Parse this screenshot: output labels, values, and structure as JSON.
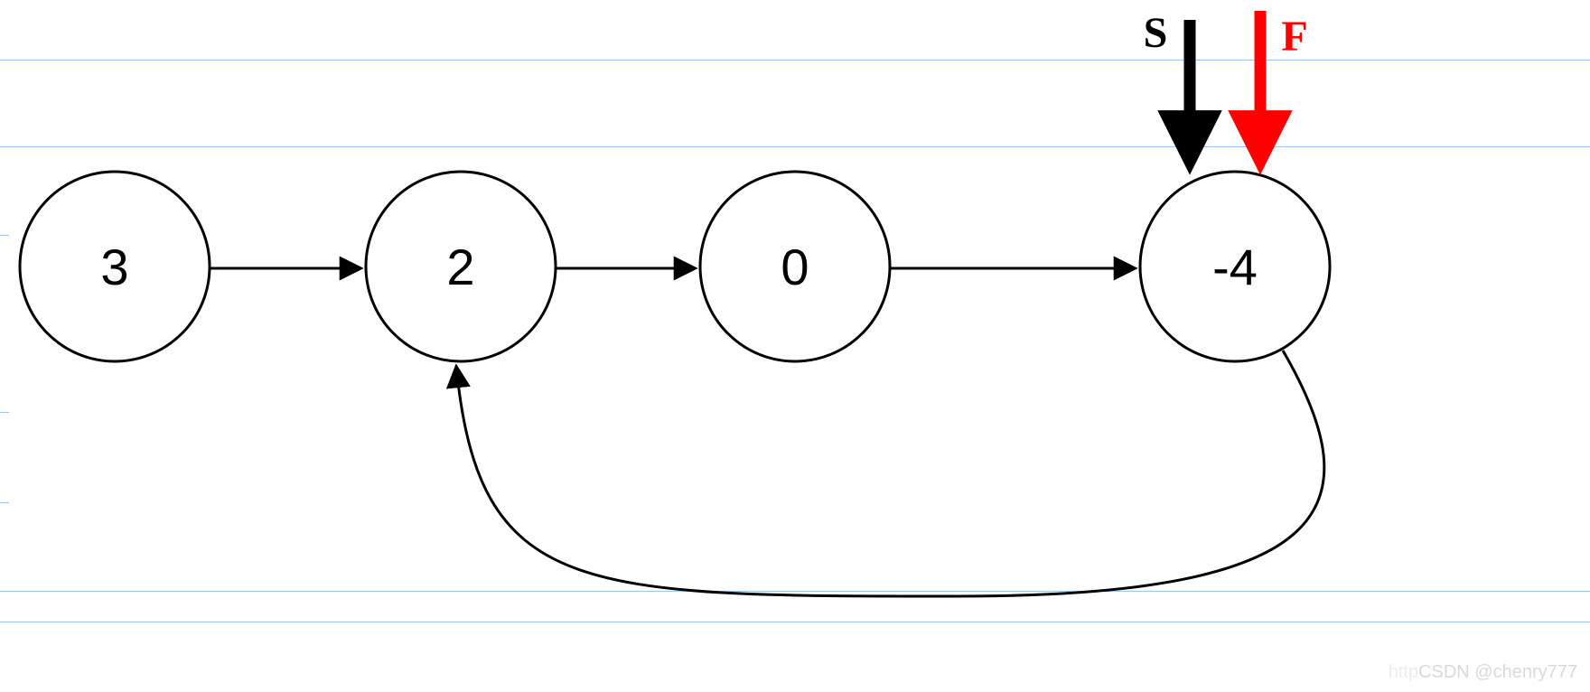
{
  "nodes": {
    "n1": "3",
    "n2": "2",
    "n3": "0",
    "n4": "-4"
  },
  "pointers": {
    "slow": "S",
    "fast": "F"
  },
  "watermark": {
    "prefix": "http",
    "text": "CSDN @chenry777"
  },
  "guide_lines": {
    "full": [
      66,
      162,
      654,
      688
    ],
    "ticks": [
      260,
      456,
      556
    ]
  }
}
